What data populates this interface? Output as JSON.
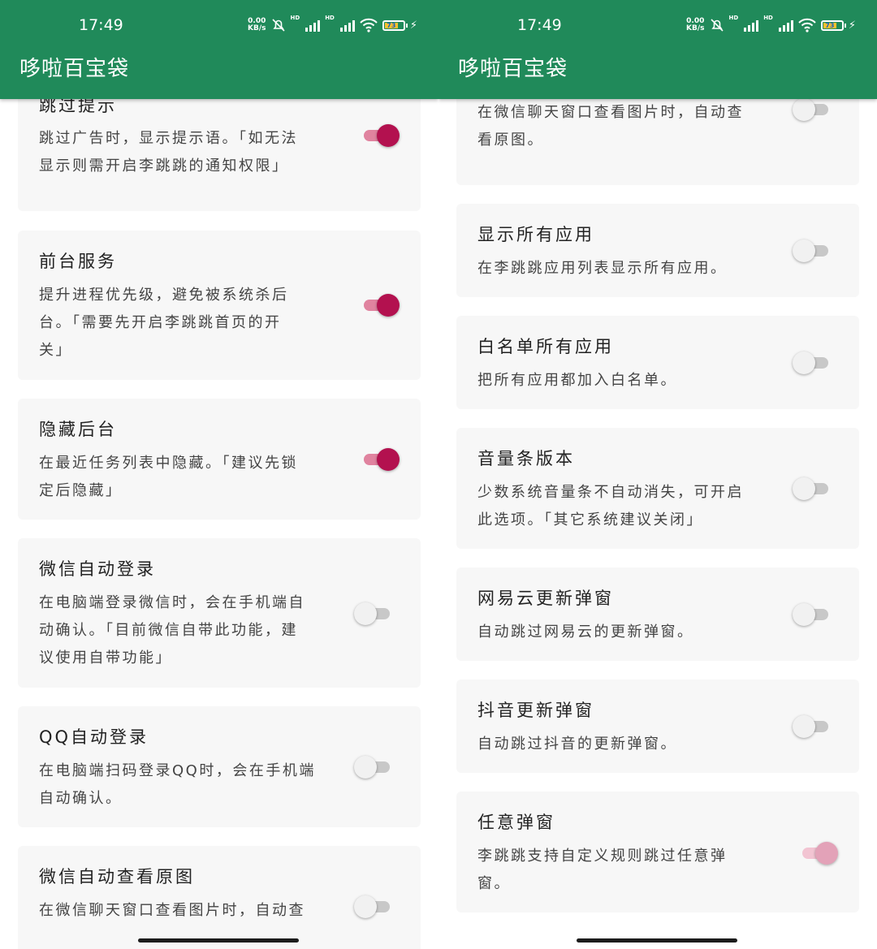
{
  "status": {
    "time": "17:49",
    "net_speed_value": "0.00",
    "net_speed_unit": "KB/s",
    "hd": "HD",
    "battery": "73",
    "charging": "⚡"
  },
  "app": {
    "title": "哆啦百宝袋"
  },
  "left": {
    "items": [
      {
        "title": "跳过提示",
        "desc": [
          "跳过广告时，显示提示语。「如无法",
          "显示则需开启李跳跳的通知权限」"
        ],
        "toggle": "on"
      },
      {
        "title": "前台服务",
        "desc": [
          "提升进程优先级，避免被系统杀后",
          "台。「需要先开启李跳跳首页的开",
          "关」"
        ],
        "toggle": "on"
      },
      {
        "title": "隐藏后台",
        "desc": [
          "在最近任务列表中隐藏。「建议先锁",
          "定后隐藏」"
        ],
        "toggle": "on"
      },
      {
        "title": "微信自动登录",
        "desc": [
          "在电脑端登录微信时，会在手机端自",
          "动确认。「目前微信自带此功能，建",
          "议使用自带功能」"
        ],
        "toggle": "off"
      },
      {
        "title": "QQ自动登录",
        "desc": [
          "在电脑端扫码登录QQ时，会在手机端",
          "自动确认。"
        ],
        "toggle": "off"
      },
      {
        "title": "微信自动查看原图",
        "desc": [
          "在微信聊天窗口查看图片时，自动查"
        ],
        "toggle": "off"
      }
    ]
  },
  "right": {
    "items": [
      {
        "title": "",
        "desc": [
          "在微信聊天窗口查看图片时，自动查",
          "看原图。"
        ],
        "toggle": "off"
      },
      {
        "title": "显示所有应用",
        "desc": [
          "在李跳跳应用列表显示所有应用。"
        ],
        "toggle": "off"
      },
      {
        "title": "白名单所有应用",
        "desc": [
          "把所有应用都加入白名单。"
        ],
        "toggle": "off"
      },
      {
        "title": "音量条版本",
        "desc": [
          "少数系统音量条不自动消失，可开启",
          "此选项。「其它系统建议关闭」"
        ],
        "toggle": "off"
      },
      {
        "title": "网易云更新弹窗",
        "desc": [
          "自动跳过网易云的更新弹窗。"
        ],
        "toggle": "off"
      },
      {
        "title": "抖音更新弹窗",
        "desc": [
          "自动跳过抖音的更新弹窗。"
        ],
        "toggle": "off"
      },
      {
        "title": "任意弹窗",
        "desc": [
          "李跳跳支持自定义规则跳过任意弹",
          "窗。"
        ],
        "toggle": "on-dim"
      }
    ]
  }
}
